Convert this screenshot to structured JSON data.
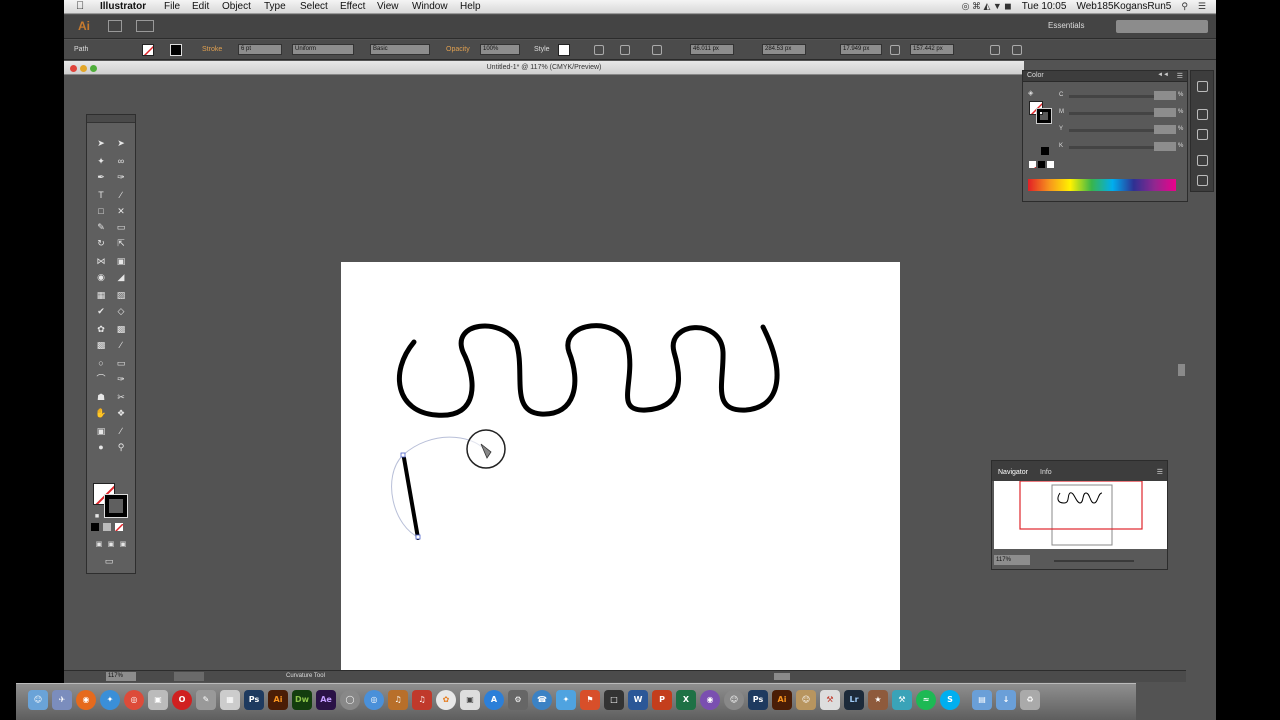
{
  "menubar": {
    "apple_icon": "apple-icon",
    "app_name": "Illustrator",
    "menus": [
      "File",
      "Edit",
      "Object",
      "Type",
      "Select",
      "Effect",
      "View",
      "Window",
      "Help"
    ],
    "clock": "Tue 10:05",
    "user": "Web185KogansRun5"
  },
  "appbar": {
    "logo": "Ai",
    "workspace": "Essentials"
  },
  "controlbar": {
    "selection_type": "Path",
    "stroke_label": "Stroke",
    "stroke_weight": "6 pt",
    "profile": "Uniform",
    "brush": "Basic",
    "opacity_label": "Opacity",
    "opacity_value": "100%",
    "style_label": "Style",
    "x": "46.011 px",
    "y": "284.53 px",
    "w": "17.949 px",
    "h": "157.442 px"
  },
  "document": {
    "title": "Untitled-1* @ 117% (CMYK/Preview)"
  },
  "color_panel": {
    "tab": "Color",
    "channels": [
      "C",
      "M",
      "Y",
      "K"
    ],
    "unit": "%"
  },
  "navigator": {
    "tabs": [
      "Navigator",
      "Info"
    ],
    "zoom": "117%"
  },
  "statusbar": {
    "zoom": "117%",
    "status": "Curvature Tool"
  },
  "colors": {
    "ui_bg": "#535353",
    "artboard": "#ffffff",
    "stroke": "#000000",
    "none_red": "#e0262b",
    "ai_orange": "#c87b2e"
  },
  "dock_apps": [
    "Ps",
    "Ai",
    "Dw",
    "Ae",
    "W",
    "X",
    "Ps",
    "Ai",
    "Lr",
    "S"
  ]
}
